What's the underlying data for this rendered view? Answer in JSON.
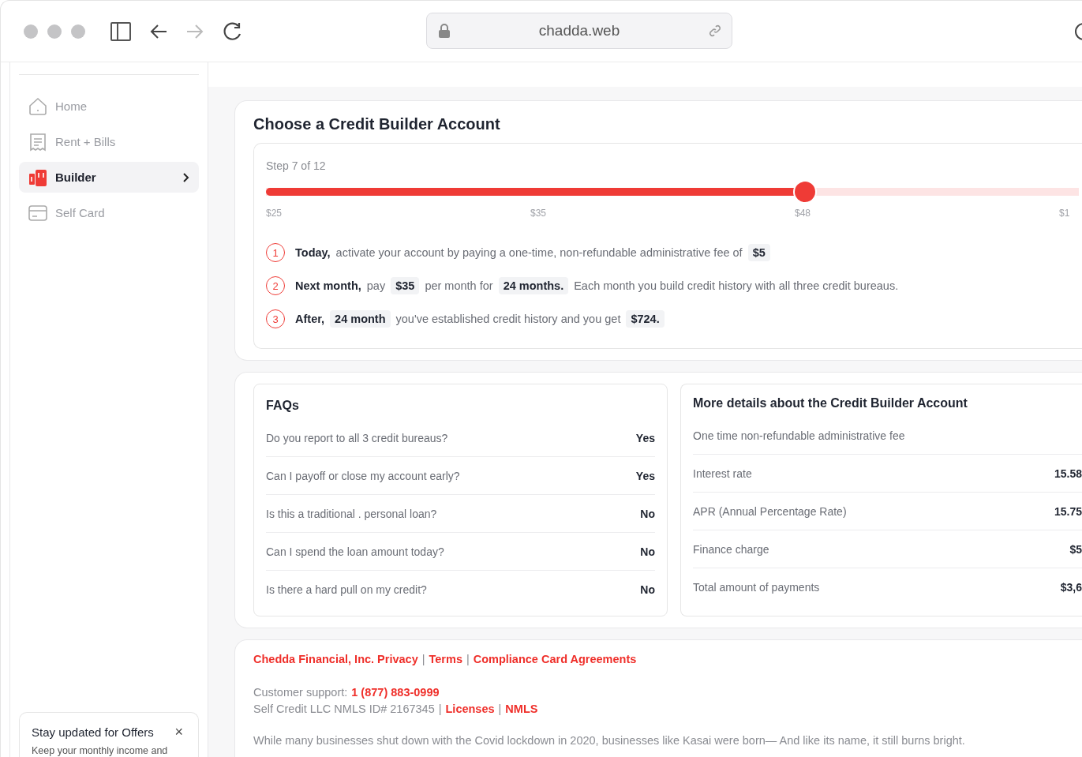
{
  "browser": {
    "url": "chadda.web",
    "forward_disabled": true
  },
  "sidebar": {
    "items": [
      {
        "label": "Home",
        "kind": "home",
        "selected": false
      },
      {
        "label": "Rent + Bills",
        "kind": "receipt",
        "selected": false
      },
      {
        "label": "Builder",
        "kind": "builder",
        "selected": true
      },
      {
        "label": "Self Card",
        "kind": "card",
        "selected": false
      }
    ],
    "promo": {
      "title": "Stay updated for Offers",
      "close": "×",
      "text": "Keep your monthly income and"
    }
  },
  "builder": {
    "title": "Choose a Credit Builder Account",
    "step": "Step 7 of 12",
    "slider": {
      "level": 0.663
    },
    "ticks": [
      "$25",
      "$35",
      "$48",
      "$1"
    ],
    "steps": [
      {
        "number": "1",
        "parts": [
          {
            "kind": "bold",
            "text": "Today,"
          },
          {
            "kind": "plain",
            "text": "activate your account by paying a one-time, non-refundable administrative fee of"
          },
          {
            "kind": "chip",
            "text": "$5"
          }
        ]
      },
      {
        "number": "2",
        "parts": [
          {
            "kind": "bold",
            "text": "Next month,"
          },
          {
            "kind": "plain",
            "text": "pay"
          },
          {
            "kind": "chip",
            "text": "$35"
          },
          {
            "kind": "plain",
            "text": "per month for"
          },
          {
            "kind": "chip",
            "text": "24 months."
          },
          {
            "kind": "plain",
            "text": "Each month you build credit history with all three credit bureaus."
          }
        ]
      },
      {
        "number": "3",
        "parts": [
          {
            "kind": "bold",
            "text": "After,"
          },
          {
            "kind": "chip",
            "text": "24 month"
          },
          {
            "kind": "plain",
            "text": "you've  established credit history and you get"
          },
          {
            "kind": "chip",
            "text": "$724."
          }
        ]
      }
    ]
  },
  "faqs": {
    "title": "FAQs",
    "rows": [
      {
        "question": "Do you report to all 3 credit bureaus?",
        "answer": "Yes"
      },
      {
        "question": "Can I payoff or close my account early?",
        "answer": "Yes"
      },
      {
        "question": "Is this a traditional . personal loan?",
        "answer": "No"
      },
      {
        "question": "Can I spend the loan amount today?",
        "answer": "No"
      },
      {
        "question": "Is there a hard pull on my credit?",
        "answer": "No"
      }
    ]
  },
  "details": {
    "title": "More details about the Credit Builder Account",
    "rows": [
      {
        "label": "One time non-refundable administrative fee"
      },
      {
        "label": "Interest rate",
        "value": "15.58"
      },
      {
        "label": "APR (Annual Percentage Rate)",
        "value": "15.75"
      },
      {
        "label": "Finance charge",
        "value": "$5"
      },
      {
        "label": "Total amount of payments",
        "value": "$3,6"
      }
    ]
  },
  "footer": {
    "lines": [
      [
        {
          "kind": "link",
          "text": "Chedda Financial, Inc. Privacy"
        },
        {
          "kind": "sep",
          "text": "|"
        },
        {
          "kind": "link",
          "text": "Terms"
        },
        {
          "kind": "sep",
          "text": "|"
        },
        {
          "kind": "link",
          "text": "Compliance Card Agreements"
        }
      ],
      [
        {
          "kind": "plain",
          "text": "Customer support:"
        },
        {
          "kind": "link",
          "text": "1 (877) 883-0999"
        }
      ],
      [
        {
          "kind": "plain",
          "text": "Self Credit LLC NMLS ID# 2167345"
        },
        {
          "kind": "sep",
          "text": "|"
        },
        {
          "kind": "link",
          "text": "Licenses"
        },
        {
          "kind": "sep",
          "text": "|"
        },
        {
          "kind": "link",
          "text": "NMLS"
        }
      ]
    ],
    "note": "While many businesses shut down with the Covid lockdown in 2020, businesses like Kasai were born— And like its name, it still burns bright."
  }
}
